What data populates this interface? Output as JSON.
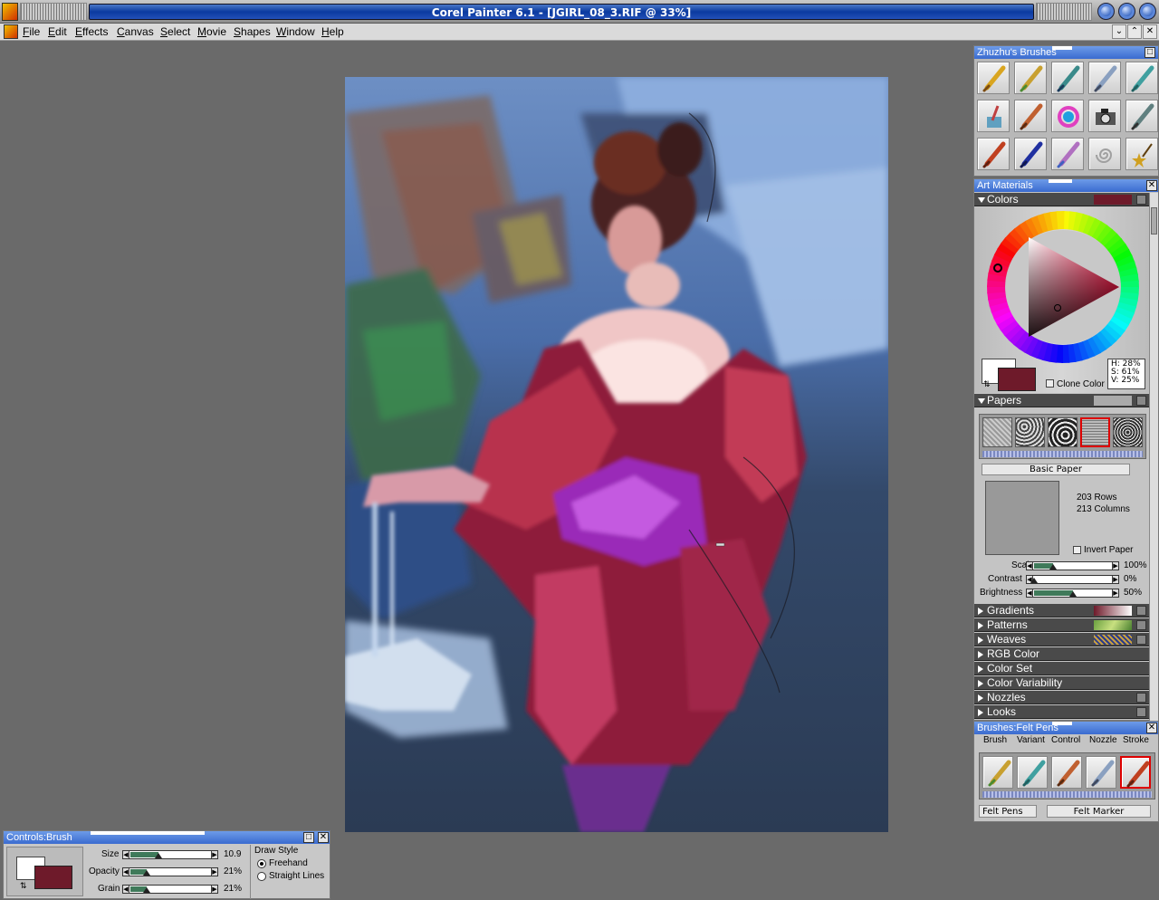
{
  "window": {
    "title": "Corel Painter 6.1 - [JGIRL_08_3.RIF @ 33%]"
  },
  "menu": {
    "items": [
      "File",
      "Edit",
      "Effects",
      "Canvas",
      "Select",
      "Movie",
      "Shapes",
      "Window",
      "Help"
    ]
  },
  "brushes_panel": {
    "title": "Zhuzhu's Brushes",
    "icons": [
      "pencil-icon",
      "colored-pencil-icon",
      "pen-icon",
      "palette-knife-icon",
      "felt-marker-icon",
      "paint-cup-icon",
      "oil-brush-icon",
      "color-wheel-icon",
      "camera-icon",
      "airbrush-icon",
      "brush-icon",
      "dip-pen-icon",
      "watercolor-brush-icon",
      "spiral-icon",
      "star-icon"
    ]
  },
  "art_materials": {
    "title": "Art Materials",
    "colors_label": "Colors",
    "clone_color": "Clone Color",
    "hsv": {
      "h": "H: 28%",
      "s": "S: 61%",
      "v": "V: 25%"
    },
    "primary_color": "#6e1a2a",
    "papers_label": "Papers",
    "paper_name": "Basic Paper",
    "rows": "203 Rows",
    "columns": "213 Columns",
    "invert_paper": "Invert Paper",
    "scale": {
      "label": "Scale",
      "value": "100%",
      "fraction": 0.25
    },
    "contrast": {
      "label": "Contrast",
      "value": "0%",
      "fraction": 0.0
    },
    "brightness": {
      "label": "Brightness",
      "value": "50%",
      "fraction": 0.5
    },
    "sections": [
      "Gradients",
      "Patterns",
      "Weaves",
      "RGB Color",
      "Color Set",
      "Color Variability",
      "Nozzles",
      "Looks"
    ]
  },
  "felt_pens_panel": {
    "title": "Brushes:Felt Pens",
    "tabs": [
      "Brush",
      "Variant",
      "Control",
      "Nozzle",
      "Stroke"
    ],
    "brush_name": "Felt Pens",
    "variant_name": "Felt Marker"
  },
  "controls_brush": {
    "title": "Controls:Brush",
    "size": {
      "label": "Size",
      "value": "10.9",
      "fraction": 0.35
    },
    "opacity": {
      "label": "Opacity",
      "value": "21%",
      "fraction": 0.21
    },
    "grain": {
      "label": "Grain",
      "value": "21%",
      "fraction": 0.21
    },
    "draw_style": "Draw Style",
    "freehand": "Freehand",
    "straight_lines": "Straight Lines"
  }
}
